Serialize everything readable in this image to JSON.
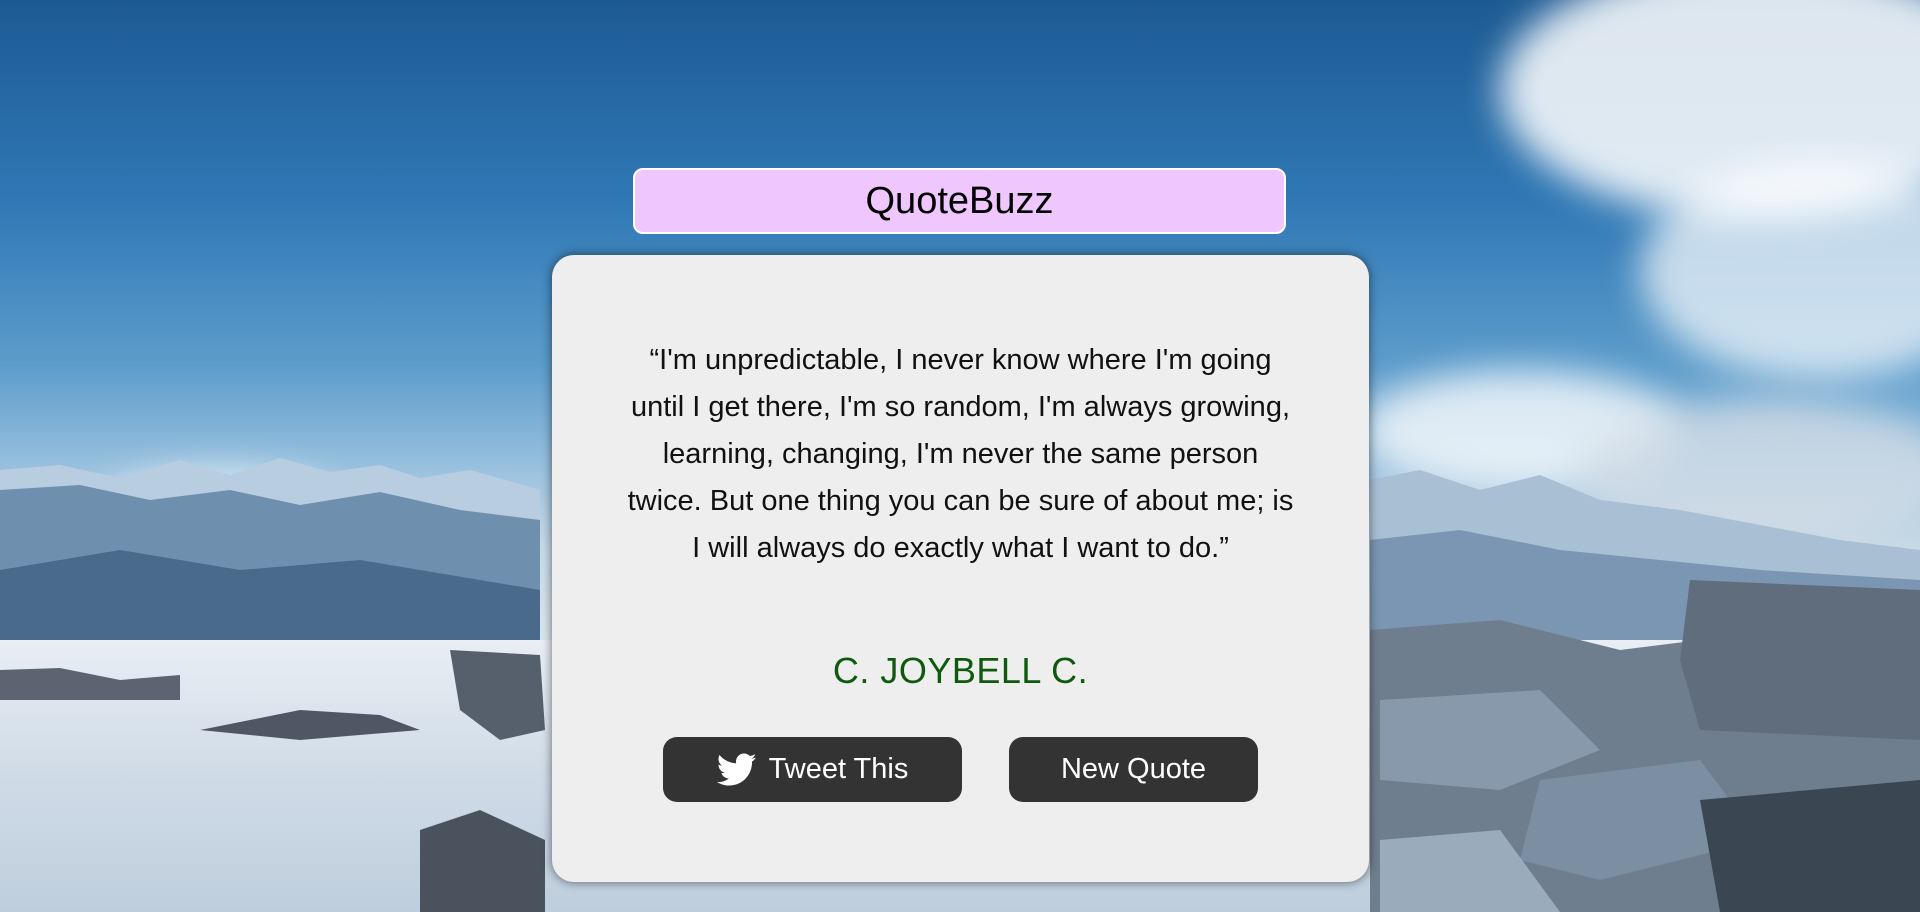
{
  "app": {
    "title": "QuoteBuzz"
  },
  "quote": {
    "text": "“I'm unpredictable, I never know where I'm going until I get there, I'm so random, I'm always growing, learning, changing, I'm never the same person twice. But one thing you can be sure of about me; is I will always do exactly what I want to do.”",
    "author": "C. JOYBELL C."
  },
  "buttons": {
    "tweet_label": "Tweet This",
    "tweet_icon": "twitter-bird-icon",
    "new_quote_label": "New Quote"
  },
  "colors": {
    "title_bg": "#efc6fd",
    "card_bg": "#eeeeee",
    "button_bg": "#333333",
    "author": "#0d5a0d"
  }
}
